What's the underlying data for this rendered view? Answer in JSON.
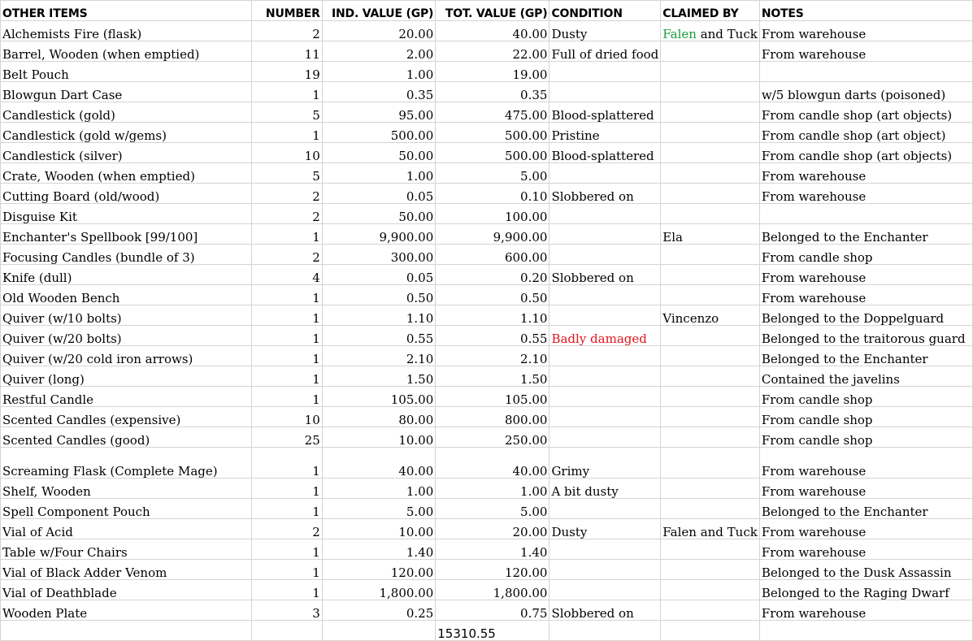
{
  "headers": {
    "item": "OTHER ITEMS",
    "number": "NUMBER",
    "ind_value": "IND. VALUE (GP)",
    "tot_value": "TOT. VALUE (GP)",
    "condition": "CONDITION",
    "claimed_by": "CLAIMED BY",
    "notes": "NOTES"
  },
  "rows": [
    {
      "item": "Alchemists Fire (flask)",
      "number": "2",
      "ind": "20.00",
      "tot": "40.00",
      "condition": "Dusty",
      "claimed_a": "Falen",
      "claimed_b": " and Tuck",
      "notes": "From warehouse"
    },
    {
      "item": "Barrel, Wooden (when emptied)",
      "number": "11",
      "ind": "2.00",
      "tot": "22.00",
      "condition": "Full of dried food",
      "claimed_a": "",
      "claimed_b": "",
      "notes": "From warehouse"
    },
    {
      "item": "Belt Pouch",
      "number": "19",
      "ind": "1.00",
      "tot": "19.00",
      "condition": "",
      "claimed_a": "",
      "claimed_b": "",
      "notes": ""
    },
    {
      "item": "Blowgun Dart Case",
      "number": "1",
      "ind": "0.35",
      "tot": "0.35",
      "condition": "",
      "claimed_a": "",
      "claimed_b": "",
      "notes": "w/5 blowgun darts (poisoned)"
    },
    {
      "item": "Candlestick (gold)",
      "number": "5",
      "ind": "95.00",
      "tot": "475.00",
      "condition": "Blood-splattered",
      "claimed_a": "",
      "claimed_b": "",
      "notes": "From candle shop (art objects)"
    },
    {
      "item": "Candlestick (gold w/gems)",
      "number": "1",
      "ind": "500.00",
      "tot": "500.00",
      "condition": "Pristine",
      "claimed_a": "",
      "claimed_b": "",
      "notes": "From candle shop (art object)"
    },
    {
      "item": "Candlestick (silver)",
      "number": "10",
      "ind": "50.00",
      "tot": "500.00",
      "condition": "Blood-splattered",
      "claimed_a": "",
      "claimed_b": "",
      "notes": "From candle shop (art objects)"
    },
    {
      "item": "Crate, Wooden (when emptied)",
      "number": "5",
      "ind": "1.00",
      "tot": "5.00",
      "condition": "",
      "claimed_a": "",
      "claimed_b": "",
      "notes": "From warehouse"
    },
    {
      "item": "Cutting Board (old/wood)",
      "number": "2",
      "ind": "0.05",
      "tot": "0.10",
      "condition": "Slobbered on",
      "claimed_a": "",
      "claimed_b": "",
      "notes": "From warehouse"
    },
    {
      "item": "Disguise Kit",
      "number": "2",
      "ind": "50.00",
      "tot": "100.00",
      "condition": "",
      "claimed_a": "",
      "claimed_b": "",
      "notes": ""
    },
    {
      "item": "Enchanter's Spellbook [99/100]",
      "number": "1",
      "ind": "9,900.00",
      "tot": "9,900.00",
      "condition": "",
      "claimed_a": "",
      "claimed_b": "Ela",
      "notes": "Belonged to the Enchanter"
    },
    {
      "item": "Focusing Candles (bundle of 3)",
      "number": "2",
      "ind": "300.00",
      "tot": "600.00",
      "condition": "",
      "claimed_a": "",
      "claimed_b": "",
      "notes": "From candle shop"
    },
    {
      "item": "Knife (dull)",
      "number": "4",
      "ind": "0.05",
      "tot": "0.20",
      "condition": "Slobbered on",
      "claimed_a": "",
      "claimed_b": "",
      "notes": "From warehouse"
    },
    {
      "item": "Old Wooden Bench",
      "number": "1",
      "ind": "0.50",
      "tot": "0.50",
      "condition": "",
      "claimed_a": "",
      "claimed_b": "",
      "notes": "From warehouse"
    },
    {
      "item": "Quiver (w/10 bolts)",
      "number": "1",
      "ind": "1.10",
      "tot": "1.10",
      "condition": "",
      "claimed_a": "",
      "claimed_b": "Vincenzo",
      "notes": "Belonged to the Doppelguard"
    },
    {
      "item": "Quiver (w/20 bolts)",
      "number": "1",
      "ind": "0.55",
      "tot": "0.55",
      "condition": "Badly damaged",
      "condition_red": true,
      "claimed_a": "",
      "claimed_b": "",
      "notes": "Belonged to the traitorous guard"
    },
    {
      "item": "Quiver (w/20 cold iron arrows)",
      "number": "1",
      "ind": "2.10",
      "tot": "2.10",
      "condition": "",
      "claimed_a": "",
      "claimed_b": "",
      "notes": "Belonged to the Enchanter"
    },
    {
      "item": "Quiver (long)",
      "number": "1",
      "ind": "1.50",
      "tot": "1.50",
      "condition": "",
      "claimed_a": "",
      "claimed_b": "",
      "notes": "Contained the javelins"
    },
    {
      "item": "Restful Candle",
      "number": "1",
      "ind": "105.00",
      "tot": "105.00",
      "condition": "",
      "claimed_a": "",
      "claimed_b": "",
      "notes": "From candle shop"
    },
    {
      "item": "Scented Candles (expensive)",
      "number": "10",
      "ind": "80.00",
      "tot": "800.00",
      "condition": "",
      "claimed_a": "",
      "claimed_b": "",
      "notes": "From candle shop"
    },
    {
      "item": "Scented Candles (good)",
      "number": "25",
      "ind": "10.00",
      "tot": "250.00",
      "condition": "",
      "claimed_a": "",
      "claimed_b": "",
      "notes": "From candle shop"
    },
    {
      "item": "Screaming Flask (Complete Mage)",
      "number": "1",
      "ind": "40.00",
      "tot": "40.00",
      "condition": "Grimy",
      "claimed_a": "",
      "claimed_b": "",
      "notes": "From warehouse",
      "tall": true
    },
    {
      "item": "Shelf, Wooden",
      "number": "1",
      "ind": "1.00",
      "tot": "1.00",
      "condition": "A bit dusty",
      "claimed_a": "",
      "claimed_b": "",
      "notes": "From warehouse"
    },
    {
      "item": "Spell Component Pouch",
      "number": "1",
      "ind": "5.00",
      "tot": "5.00",
      "condition": "",
      "claimed_a": "",
      "claimed_b": "",
      "notes": "Belonged to the Enchanter"
    },
    {
      "item": "Vial of Acid",
      "number": "2",
      "ind": "10.00",
      "tot": "20.00",
      "condition": "Dusty",
      "claimed_a": "",
      "claimed_b": "Falen and Tuck",
      "notes": "From warehouse"
    },
    {
      "item": "Table w/Four Chairs",
      "number": "1",
      "ind": "1.40",
      "tot": "1.40",
      "condition": "",
      "claimed_a": "",
      "claimed_b": "",
      "notes": "From warehouse"
    },
    {
      "item": "Vial of Black Adder Venom",
      "number": "1",
      "ind": "120.00",
      "tot": "120.00",
      "condition": "",
      "claimed_a": "",
      "claimed_b": "",
      "notes": "Belonged to the Dusk Assassin"
    },
    {
      "item": "Vial of Deathblade",
      "number": "1",
      "ind": "1,800.00",
      "tot": "1,800.00",
      "condition": "",
      "claimed_a": "",
      "claimed_b": "",
      "notes": "Belonged to the Raging Dwarf"
    },
    {
      "item": "Wooden Plate",
      "number": "3",
      "ind": "0.25",
      "tot": "0.75",
      "condition": "Slobbered on",
      "claimed_a": "",
      "claimed_b": "",
      "notes": "From warehouse"
    }
  ],
  "total": "15310.55",
  "colors": {
    "claimed_green": "#1a9e3a",
    "condition_red": "#e0141c",
    "gridline": "#d4d4d4"
  }
}
